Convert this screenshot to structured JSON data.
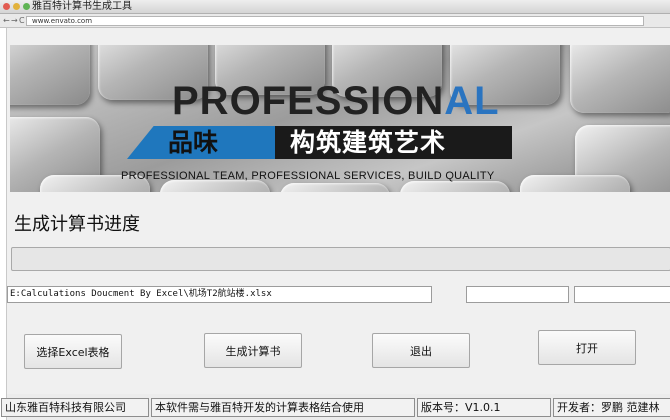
{
  "window": {
    "title": "雅百特计算书生成工具"
  },
  "browser": {
    "back": "←",
    "forward": "→",
    "reload": "C",
    "url": "www.envato.com"
  },
  "banner": {
    "brand_main": "PROFESSION",
    "brand_accent": "AL",
    "slogan_left": "品味",
    "slogan_right": "构筑建筑艺术",
    "tagline": "PROFESSIONAL TEAM, PROFESSIONAL SERVICES, BUILD QUALITY"
  },
  "progress": {
    "label": "生成计算书进度",
    "value": 0
  },
  "inputs": {
    "file_path": "E:Calculations Doucment By Excel\\机场T2航站楼.xlsx",
    "field2": "",
    "field3": ""
  },
  "buttons": {
    "select_excel": "选择Excel表格",
    "generate": "生成计算书",
    "exit": "退出",
    "open": "打开"
  },
  "status": {
    "company": "山东雅百特科技有限公司",
    "note": "本软件需与雅百特开发的计算表格结合使用",
    "version": "版本号：V1.0.1",
    "developer": "开发者：罗鹏   范建林"
  },
  "colors": {
    "accent_blue": "#1f77bd",
    "banner_black": "#1a1a1a"
  }
}
